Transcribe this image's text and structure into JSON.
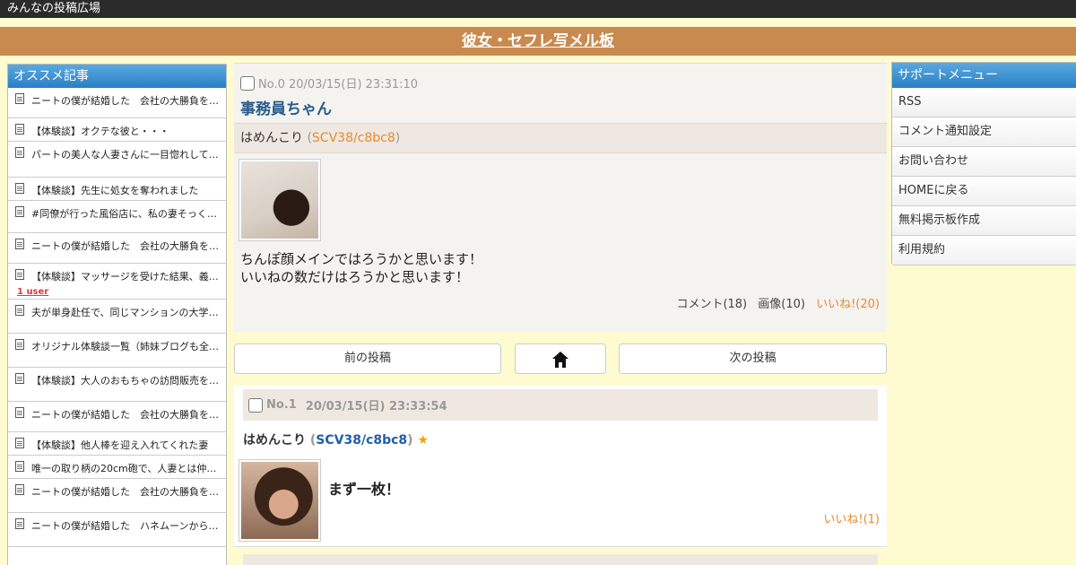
{
  "site": {
    "name": "みんなの投稿広場",
    "board_title": "彼女・セフレ写メル板"
  },
  "sidebar_left": {
    "heading": "オススメ記事",
    "items": [
      {
        "label": "ニートの僕が結婚した　会社の大勝負を引き…",
        "badge": ""
      },
      {
        "label": "【体験談】オクテな彼と・・・",
        "badge": ""
      },
      {
        "label": "パートの美人な人妻さんに一目惚れしてエッ…",
        "badge": ""
      },
      {
        "label": "【体験談】先生に処女を奪われました",
        "badge": ""
      },
      {
        "label": "#同僚が行った風俗店に、私の妻そっくりの…",
        "badge": ""
      },
      {
        "label": "ニートの僕が結婚した　会社の大勝負を引き…",
        "badge": ""
      },
      {
        "label": "【体験談】マッサージを受けた結果、義姉と…",
        "badge": "1 user"
      },
      {
        "label": "夫が単身赴任で、同じマンションの大学生に…",
        "badge": ""
      },
      {
        "label": "オリジナル体験談一覧（姉妹ブログも全て含…",
        "badge": ""
      },
      {
        "label": "【体験談】大人のおもちゃの訪問販売をして…",
        "badge": ""
      },
      {
        "label": "ニートの僕が結婚した　会社の大勝負を引き…",
        "badge": ""
      },
      {
        "label": "【体験談】他人棒を迎え入れてくれた妻",
        "badge": ""
      },
      {
        "label": "唯一の取り柄の20cm砲で、人妻とは仲良…",
        "badge": ""
      },
      {
        "label": "ニートの僕が結婚した　会社の大勝負を引き…",
        "badge": ""
      },
      {
        "label": "ニートの僕が結婚した　ハネムーンから帰っ…",
        "badge": ""
      }
    ]
  },
  "post": {
    "meta": "No.0 20/03/15(日) 23:31:10",
    "title": "事務員ちゃん",
    "author_name": "はめんこり",
    "author_open": " (",
    "author_id": "SCV38/c8bc8",
    "author_close": ")",
    "body_line1": "ちんぽ顔メインではろうかと思います！",
    "body_line2": "いいねの数だけはろうかと思います！",
    "comments": "コメント(18)",
    "images": "画像(10)",
    "likes": "いいね!(20)"
  },
  "nav": {
    "prev": "前の投稿",
    "next": "次の投稿",
    "home_icon": "home-icon"
  },
  "reply": {
    "no": "No.1",
    "date": "20/03/15(日) 23:33:54",
    "author_name": "はめんこり",
    "author_open": " (",
    "author_id": "SCV38/c8bc8",
    "author_close": ")",
    "star": "★",
    "text": "まず一枚！",
    "likes": "いいね!(1)"
  },
  "sidebar_right": {
    "heading": "サポートメニュー",
    "items": [
      "RSS",
      "コメント通知設定",
      "お問い合わせ",
      "HOMEに戻る",
      "無料掲示板作成",
      "利用規約"
    ]
  },
  "colors": {
    "background": "#fffbd0",
    "title_bar": "#c98a4f",
    "accent_orange": "#e88a2c",
    "menu_blue": "#2a7fc4"
  }
}
